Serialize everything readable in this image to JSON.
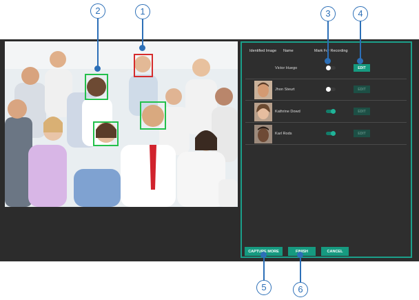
{
  "colors": {
    "accent": "#169a80",
    "detected_face": "#22c04a",
    "unidentified_face": "#d62b2b",
    "callout": "#2c6fb7"
  },
  "photo": {
    "description_icon": "group-photo",
    "face_boxes": [
      {
        "id": "1",
        "status": "unidentified"
      },
      {
        "id": "2",
        "status": "identified"
      },
      {
        "id": "3",
        "status": "identified"
      },
      {
        "id": "4",
        "status": "identified"
      }
    ]
  },
  "panel": {
    "headers": {
      "identified_image": "Identified Image",
      "name": "Name",
      "mark_for_recording": "Mark For Recording"
    },
    "rows": [
      {
        "name": "Victor    Huego",
        "has_thumbnail": false,
        "marked": false,
        "edit_label": "EDIT",
        "edit_active": true
      },
      {
        "name": "Jhon    Steurt",
        "has_thumbnail": true,
        "marked": false,
        "edit_label": "EDIT",
        "edit_active": false
      },
      {
        "name": "Kathrine    Dowd",
        "has_thumbnail": true,
        "marked": true,
        "edit_label": "EDIT",
        "edit_active": false
      },
      {
        "name": "Karl    Rods",
        "has_thumbnail": true,
        "marked": true,
        "edit_label": "EDIT",
        "edit_active": false
      }
    ],
    "buttons": {
      "capture_more": "CAPTURE MORE",
      "finish": "FINISH",
      "cancel": "CANCEL"
    }
  },
  "callouts": [
    "1",
    "2",
    "3",
    "4",
    "5",
    "6"
  ]
}
